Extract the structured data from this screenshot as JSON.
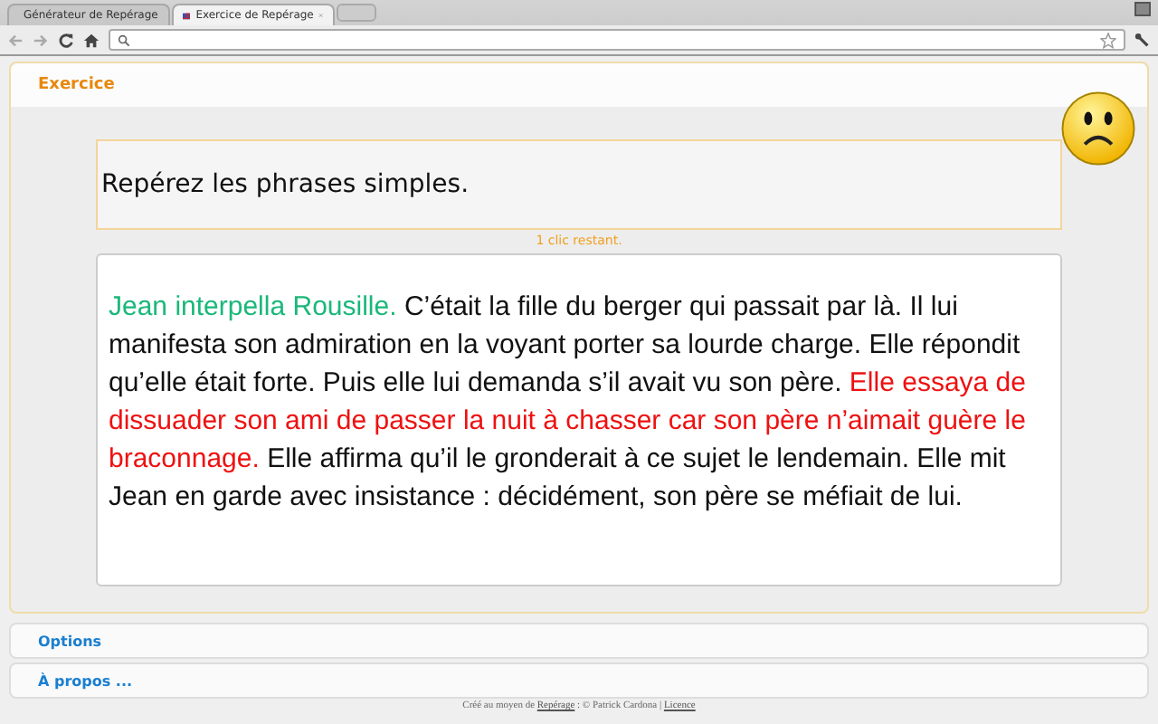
{
  "browser": {
    "tabs": [
      {
        "title": "Générateur de Repérage",
        "selected": false
      },
      {
        "title": "Exercice de Repérage",
        "selected": true
      }
    ]
  },
  "panel": {
    "title": "Exercice"
  },
  "instruction": "Repérez les phrases simples.",
  "status": "1 clic restant.",
  "sentences": [
    {
      "text": "Jean interpella Rousille.",
      "color": "#1ab87a"
    },
    {
      "text": "C’était la fille du berger qui passait par là.",
      "color": "#111111"
    },
    {
      "text": "Il lui manifesta son admiration en la voyant porter sa lourde charge.",
      "color": "#111111"
    },
    {
      "text": "Elle répondit qu’elle était forte.",
      "color": "#111111"
    },
    {
      "text": "Puis elle lui demanda s’il avait vu son père.",
      "color": "#111111"
    },
    {
      "text": "Elle essaya de dissuader son ami de passer la nuit à chasser car son père n’aimait guère le braconnage.",
      "color": "#ee1111"
    },
    {
      "text": "Elle affirma qu’il le gronderait à ce sujet le lendemain.",
      "color": "#111111"
    },
    {
      "text": "Elle mit Jean en garde avec insistance : décidément, son père se méfiait de lui.",
      "color": "#111111"
    }
  ],
  "sections": [
    "Options",
    "À propos ..."
  ],
  "footer": {
    "text": "Créé au moyen de",
    "link": "Repérage",
    "credit": ": © Patrick Cardona |",
    "license": "Licence"
  }
}
